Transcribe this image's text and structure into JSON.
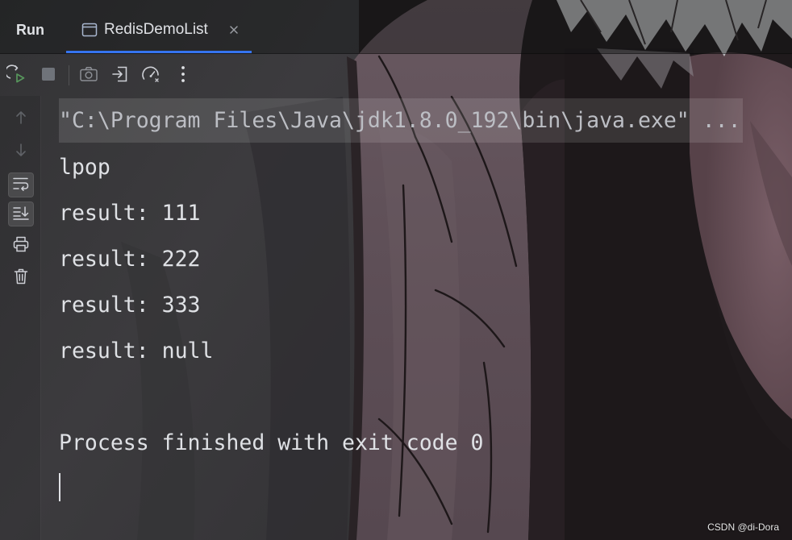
{
  "tool_window": {
    "title": "Run",
    "tab": {
      "label": "RedisDemoList",
      "icon": "console-window-icon",
      "close_icon": "close-icon",
      "active": true
    }
  },
  "toolbar": [
    {
      "icon": "rerun-icon",
      "enabled": true
    },
    {
      "icon": "stop-icon",
      "enabled": false
    },
    {
      "icon": "camera-icon",
      "enabled": false
    },
    {
      "icon": "exit-icon",
      "enabled": true
    },
    {
      "icon": "gauge-icon",
      "enabled": true
    },
    {
      "icon": "more-vertical-icon",
      "enabled": true
    }
  ],
  "sidebar": [
    {
      "icon": "arrow-up-icon",
      "enabled": false
    },
    {
      "icon": "arrow-down-icon",
      "enabled": false
    },
    {
      "icon": "soft-wrap-icon",
      "toggled": true
    },
    {
      "icon": "scroll-to-end-icon",
      "toggled": true
    },
    {
      "icon": "print-icon",
      "enabled": true
    },
    {
      "icon": "trash-icon",
      "enabled": true
    }
  ],
  "console": {
    "command_line": "\"C:\\Program Files\\Java\\jdk1.8.0_192\\bin\\java.exe\" ...",
    "output": [
      "lpop",
      "result: 111",
      "result: 222",
      "result: 333",
      "result: null",
      "",
      "Process finished with exit code 0"
    ]
  },
  "watermark": "CSDN @di-Dora",
  "colors": {
    "accent": "#3574f0",
    "run_green": "#57965c",
    "text": "#dfe1e5",
    "muted_text": "#bcbec4",
    "icon": "#ced0d6",
    "icon_disabled": "#5f6267"
  }
}
